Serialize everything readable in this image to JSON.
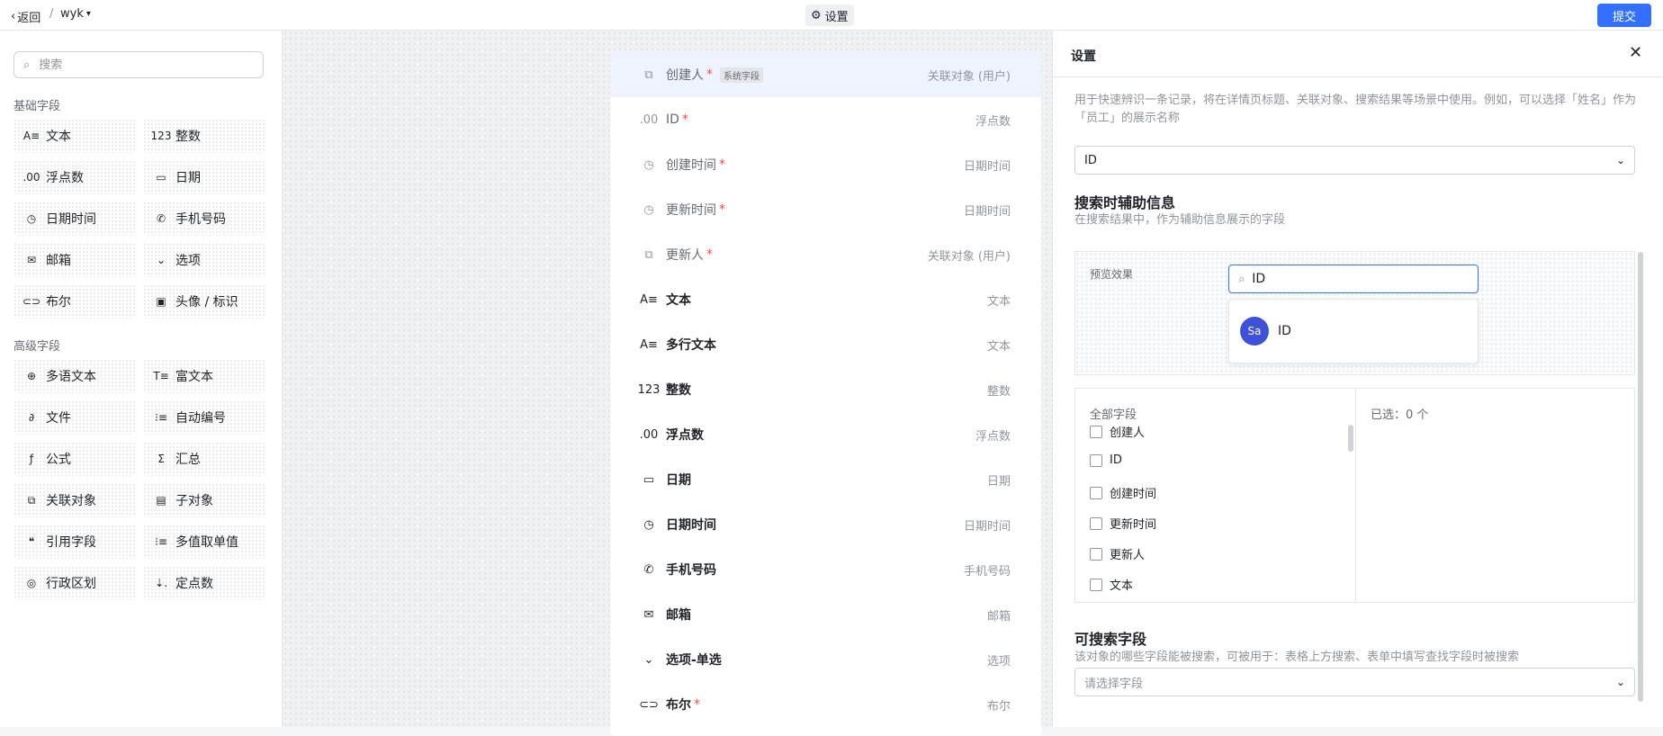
{
  "topbar": {
    "back_label": "返回",
    "separator": "/",
    "app_name": "wyk",
    "settings_tab": "设置",
    "submit_label": "提交"
  },
  "sidebar": {
    "search_placeholder": "搜索",
    "basic_title": "基础字段",
    "basic_fields": [
      {
        "label": "文本",
        "icon": "text-icon",
        "glyph": "A≡"
      },
      {
        "label": "整数",
        "icon": "integer-icon",
        "glyph": "123"
      },
      {
        "label": "浮点数",
        "icon": "float-icon",
        "glyph": ".00"
      },
      {
        "label": "日期",
        "icon": "calendar-icon",
        "glyph": "▭"
      },
      {
        "label": "日期时间",
        "icon": "clock-icon",
        "glyph": "◷"
      },
      {
        "label": "手机号码",
        "icon": "phone-icon",
        "glyph": "✆"
      },
      {
        "label": "邮箱",
        "icon": "mail-icon",
        "glyph": "✉"
      },
      {
        "label": "选项",
        "icon": "option-icon",
        "glyph": "⌄"
      },
      {
        "label": "布尔",
        "icon": "toggle-icon",
        "glyph": "⊂⊃"
      },
      {
        "label": "头像 / 标识",
        "icon": "image-icon",
        "glyph": "▣"
      }
    ],
    "advanced_title": "高级字段",
    "advanced_fields": [
      {
        "label": "多语文本",
        "icon": "globe-icon",
        "glyph": "⊕"
      },
      {
        "label": "富文本",
        "icon": "rich-text-icon",
        "glyph": "T≡"
      },
      {
        "label": "文件",
        "icon": "paperclip-icon",
        "glyph": "∂"
      },
      {
        "label": "自动编号",
        "icon": "auto-number-icon",
        "glyph": "⁝≡"
      },
      {
        "label": "公式",
        "icon": "formula-icon",
        "glyph": "ƒ"
      },
      {
        "label": "汇总",
        "icon": "sum-icon",
        "glyph": "Σ"
      },
      {
        "label": "关联对象",
        "icon": "link-object-icon",
        "glyph": "⧉"
      },
      {
        "label": "子对象",
        "icon": "sub-object-icon",
        "glyph": "▤"
      },
      {
        "label": "引用字段",
        "icon": "quote-icon",
        "glyph": "❝"
      },
      {
        "label": "多值取单值",
        "icon": "list-icon",
        "glyph": "⁝≡"
      },
      {
        "label": "行政区划",
        "icon": "region-icon",
        "glyph": "◎"
      },
      {
        "label": "定点数",
        "icon": "decimal-icon",
        "glyph": "⇣."
      }
    ]
  },
  "form_rows": [
    {
      "name": "创建人",
      "required": "*",
      "tag": "系统字段",
      "type": "关联对象 (用户)",
      "icon": "link-object-icon",
      "glyph": "⧉",
      "system": true
    },
    {
      "name": "ID",
      "required": "*",
      "tag": "",
      "type": "浮点数",
      "icon": "float-icon",
      "glyph": ".00",
      "system": true
    },
    {
      "name": "创建时间",
      "required": "*",
      "tag": "",
      "type": "日期时间",
      "icon": "clock-icon",
      "glyph": "◷",
      "system": true
    },
    {
      "name": "更新时间",
      "required": "*",
      "tag": "",
      "type": "日期时间",
      "icon": "clock-icon",
      "glyph": "◷",
      "system": true
    },
    {
      "name": "更新人",
      "required": "*",
      "tag": "",
      "type": "关联对象 (用户)",
      "icon": "link-object-icon",
      "glyph": "⧉",
      "system": true
    },
    {
      "name": "文本",
      "required": "",
      "tag": "",
      "type": "文本",
      "icon": "text-icon",
      "glyph": "A≡",
      "system": false
    },
    {
      "name": "多行文本",
      "required": "",
      "tag": "",
      "type": "文本",
      "icon": "text-icon",
      "glyph": "A≡",
      "system": false
    },
    {
      "name": "整数",
      "required": "",
      "tag": "",
      "type": "整数",
      "icon": "integer-icon",
      "glyph": "123",
      "system": false
    },
    {
      "name": "浮点数",
      "required": "",
      "tag": "",
      "type": "浮点数",
      "icon": "float-icon",
      "glyph": ".00",
      "system": false
    },
    {
      "name": "日期",
      "required": "",
      "tag": "",
      "type": "日期",
      "icon": "calendar-icon",
      "glyph": "▭",
      "system": false
    },
    {
      "name": "日期时间",
      "required": "",
      "tag": "",
      "type": "日期时间",
      "icon": "clock-icon",
      "glyph": "◷",
      "system": false
    },
    {
      "name": "手机号码",
      "required": "",
      "tag": "",
      "type": "手机号码",
      "icon": "phone-icon",
      "glyph": "✆",
      "system": false
    },
    {
      "name": "邮箱",
      "required": "",
      "tag": "",
      "type": "邮箱",
      "icon": "mail-icon",
      "glyph": "✉",
      "system": false
    },
    {
      "name": "选项-单选",
      "required": "",
      "tag": "",
      "type": "选项",
      "icon": "option-icon",
      "glyph": "⌄",
      "system": false
    },
    {
      "name": "布尔",
      "required": "*",
      "tag": "",
      "type": "布尔",
      "icon": "toggle-icon",
      "glyph": "⊂⊃",
      "system": false
    }
  ],
  "panel": {
    "title": "设置",
    "display_desc": "用于快速辨识一条记录，将在详情页标题、关联对象、搜索结果等场景中使用。例如，可以选择「姓名」作为「员工」的展示名称",
    "display_value": "ID",
    "aux_title": "搜索时辅助信息",
    "aux_desc": "在搜索结果中，作为辅助信息展示的字段",
    "preview_label": "预览效果",
    "preview_search_value": "ID",
    "preview_avatar": "Sa",
    "preview_result": "ID",
    "all_fields_label": "全部字段",
    "checkbox_fields": [
      "创建人",
      "ID",
      "创建时间",
      "更新时间",
      "更新人",
      "文本"
    ],
    "selected_label": "已选：0 个",
    "searchable_title": "可搜索字段",
    "searchable_desc": "该对象的哪些字段能被搜索，可被用于：表格上方搜索、表单中填写查找字段时被搜索",
    "searchable_placeholder": "请选择字段"
  },
  "colors": {
    "accent": "#3370ff",
    "required": "#f54a45",
    "avatar": "#3f51d6",
    "selected_row": "#eef3ff"
  }
}
